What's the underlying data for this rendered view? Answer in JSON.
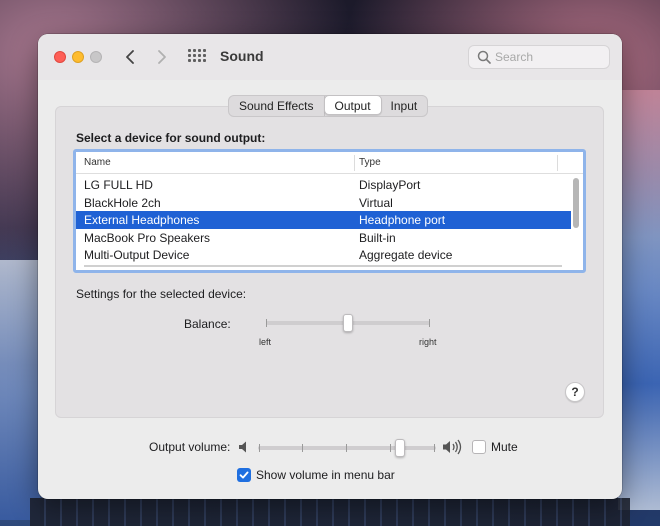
{
  "window": {
    "title": "Sound"
  },
  "search": {
    "placeholder": "Search"
  },
  "tabs": [
    {
      "label": "Sound Effects",
      "active": false
    },
    {
      "label": "Output",
      "active": true
    },
    {
      "label": "Input",
      "active": false
    }
  ],
  "output": {
    "section_title": "Select a device for sound output:",
    "columns": {
      "name": "Name",
      "type": "Type"
    },
    "devices": [
      {
        "name": "LG FULL HD",
        "type": "DisplayPort",
        "selected": false
      },
      {
        "name": "BlackHole 2ch",
        "type": "Virtual",
        "selected": false
      },
      {
        "name": "External Headphones",
        "type": "Headphone port",
        "selected": true
      },
      {
        "name": "MacBook Pro Speakers",
        "type": "Built-in",
        "selected": false
      },
      {
        "name": "Multi-Output Device",
        "type": "Aggregate device",
        "selected": false
      }
    ],
    "settings_label": "Settings for the selected device:",
    "balance": {
      "label": "Balance:",
      "left_label": "left",
      "right_label": "right",
      "value": 0.5
    },
    "help_label": "?"
  },
  "volume": {
    "label": "Output volume:",
    "value": 0.8,
    "mute_label": "Mute",
    "muted": false,
    "show_in_menu_bar_label": "Show volume in menu bar",
    "show_in_menu_bar": true
  },
  "colors": {
    "selection": "#1f61d4",
    "checkbox": "#1f6fe0",
    "focus_ring": "#8fb4ea"
  }
}
